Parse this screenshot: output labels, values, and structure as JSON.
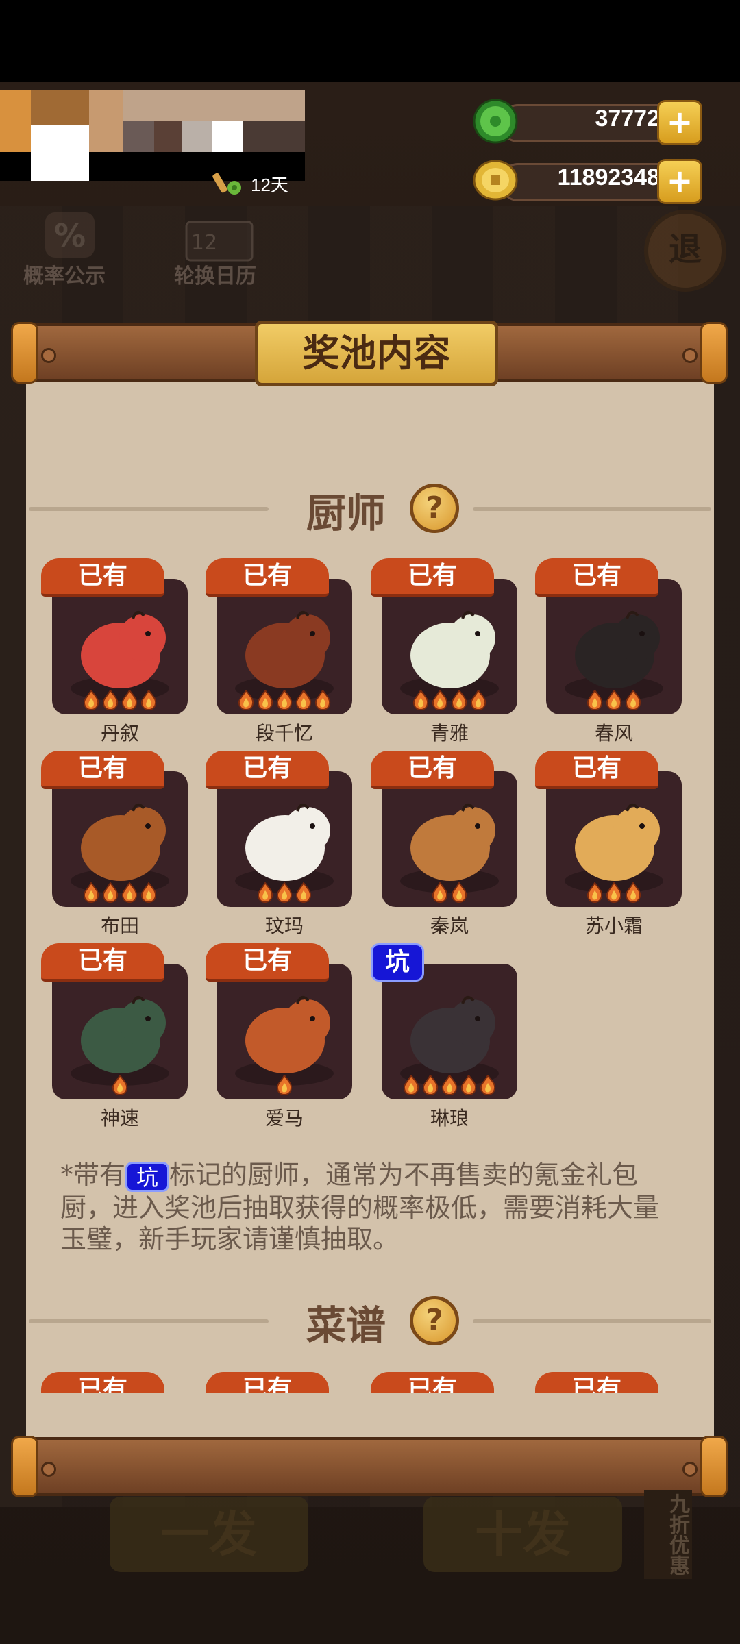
{
  "header": {
    "days_label": "12天",
    "jade_amount": "37772",
    "coin_amount": "11892348",
    "plus_symbol": "+"
  },
  "background_menu": {
    "probability_label": "概率公示",
    "probability_icon_text": "%",
    "calendar_label": "轮换日历",
    "calendar_icon_text": "12",
    "close_label": "退"
  },
  "panel": {
    "title": "奖池内容",
    "chefs_section_title": "厨师",
    "recipes_section_title": "菜谱",
    "help_symbol": "?",
    "owned_label": "已有",
    "pit_label": "坑"
  },
  "chefs": [
    {
      "name": "丹叙",
      "badge": "已有",
      "stars": 4,
      "color": "#d8453c"
    },
    {
      "name": "段千忆",
      "badge": "已有",
      "stars": 5,
      "color": "#8a3a22"
    },
    {
      "name": "青雅",
      "badge": "已有",
      "stars": 4,
      "color": "#e6ead8"
    },
    {
      "name": "春风",
      "badge": "已有",
      "stars": 3,
      "color": "#2a2424"
    },
    {
      "name": "布田",
      "badge": "已有",
      "stars": 4,
      "color": "#a85a28"
    },
    {
      "name": "玟玛",
      "badge": "已有",
      "stars": 3,
      "color": "#f2efe8"
    },
    {
      "name": "秦岚",
      "badge": "已有",
      "stars": 2,
      "color": "#c07a3c"
    },
    {
      "name": "苏小霜",
      "badge": "已有",
      "stars": 3,
      "color": "#e2ab58"
    },
    {
      "name": "神速",
      "badge": "已有",
      "stars": 1,
      "color": "#3c5a44"
    },
    {
      "name": "爱马",
      "badge": "已有",
      "stars": 1,
      "color": "#c25a2a"
    },
    {
      "name": "琳琅",
      "badge": "坑",
      "stars": 5,
      "color": "#3a3236"
    }
  ],
  "note": {
    "prefix": "*带有",
    "suffix": "标记的厨师，通常为不再售卖的氪金礼包厨，进入奖池后抽取获得的概率极低，需要消耗大量玉璧，新手玩家请谨慎抽取。"
  },
  "recipes_preview": [
    "已有",
    "已有",
    "已有",
    "已有"
  ],
  "bottom": {
    "single_draw": "一发",
    "ten_draw": "十发",
    "discount_tag": "九折优惠"
  }
}
